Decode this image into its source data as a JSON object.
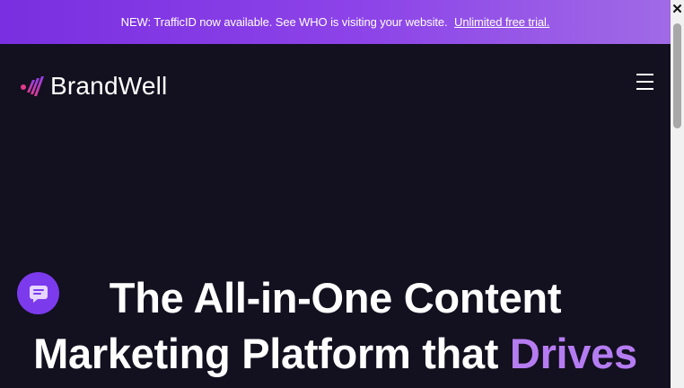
{
  "banner": {
    "message": "NEW: TrafficID now available. See WHO is visiting your website.",
    "link_text": "Unlimited free trial."
  },
  "header": {
    "logo_text": "BrandWell",
    "menu_icon": "hamburger-menu-icon"
  },
  "hero": {
    "line1": "The All-in-One Content",
    "line2_prefix": "Marketing Platform that ",
    "line2_accent": "Drives",
    "badge_icon": "chat-bubble-icon"
  },
  "colors": {
    "background": "#13101f",
    "banner_start": "#7a2fe0",
    "banner_end": "#a06ae6",
    "accent": "#b57cf2",
    "badge": "#7c3aed"
  }
}
